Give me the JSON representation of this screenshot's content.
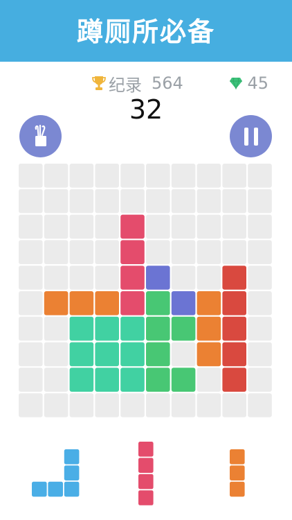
{
  "header": {
    "title": "蹲厕所必备"
  },
  "stats": {
    "record_label": "纪录",
    "record_value": "564",
    "gems_value": "45",
    "score": "32"
  },
  "colors": {
    "banner": "#46aee0",
    "empty": "#ebebeb",
    "pink": "#e44c6c",
    "blue": "#6b74d3",
    "orange": "#eb8133",
    "red": "#d9493f",
    "green": "#48c774",
    "teal": "#41d1a2",
    "cyan": "#4aaee6",
    "button": "#7b88d2"
  },
  "board": {
    "rows": 10,
    "cols": 10,
    "filled": [
      {
        "r": 2,
        "c": 4,
        "color": "pink"
      },
      {
        "r": 3,
        "c": 4,
        "color": "pink"
      },
      {
        "r": 4,
        "c": 4,
        "color": "pink"
      },
      {
        "r": 4,
        "c": 5,
        "color": "blue"
      },
      {
        "r": 4,
        "c": 8,
        "color": "red"
      },
      {
        "r": 5,
        "c": 1,
        "color": "orange"
      },
      {
        "r": 5,
        "c": 2,
        "color": "orange"
      },
      {
        "r": 5,
        "c": 3,
        "color": "orange"
      },
      {
        "r": 5,
        "c": 4,
        "color": "pink"
      },
      {
        "r": 5,
        "c": 5,
        "color": "green"
      },
      {
        "r": 5,
        "c": 6,
        "color": "blue"
      },
      {
        "r": 5,
        "c": 7,
        "color": "orange"
      },
      {
        "r": 5,
        "c": 8,
        "color": "red"
      },
      {
        "r": 6,
        "c": 2,
        "color": "teal"
      },
      {
        "r": 6,
        "c": 3,
        "color": "teal"
      },
      {
        "r": 6,
        "c": 4,
        "color": "teal"
      },
      {
        "r": 6,
        "c": 5,
        "color": "green"
      },
      {
        "r": 6,
        "c": 6,
        "color": "green"
      },
      {
        "r": 6,
        "c": 7,
        "color": "orange"
      },
      {
        "r": 6,
        "c": 8,
        "color": "red"
      },
      {
        "r": 7,
        "c": 2,
        "color": "teal"
      },
      {
        "r": 7,
        "c": 3,
        "color": "teal"
      },
      {
        "r": 7,
        "c": 4,
        "color": "teal"
      },
      {
        "r": 7,
        "c": 5,
        "color": "green"
      },
      {
        "r": 7,
        "c": 7,
        "color": "orange"
      },
      {
        "r": 7,
        "c": 8,
        "color": "red"
      },
      {
        "r": 8,
        "c": 2,
        "color": "teal"
      },
      {
        "r": 8,
        "c": 3,
        "color": "teal"
      },
      {
        "r": 8,
        "c": 4,
        "color": "teal"
      },
      {
        "r": 8,
        "c": 5,
        "color": "green"
      },
      {
        "r": 8,
        "c": 6,
        "color": "green"
      },
      {
        "r": 8,
        "c": 8,
        "color": "red"
      }
    ]
  },
  "tray": [
    {
      "name": "tray-piece-j",
      "color": "cyan",
      "cells": [
        [
          0,
          2
        ],
        [
          1,
          2
        ],
        [
          2,
          0
        ],
        [
          2,
          1
        ],
        [
          2,
          2
        ]
      ]
    },
    {
      "name": "tray-piece-i4",
      "color": "pink",
      "cells": [
        [
          0,
          0
        ],
        [
          1,
          0
        ],
        [
          2,
          0
        ],
        [
          3,
          0
        ]
      ]
    },
    {
      "name": "tray-piece-i3",
      "color": "orange",
      "cells": [
        [
          0,
          0
        ],
        [
          1,
          0
        ],
        [
          2,
          0
        ]
      ]
    }
  ],
  "icons": {
    "trophy": "trophy-icon",
    "gem": "gem-icon",
    "hammer": "hammer-icon",
    "pause": "pause-icon"
  }
}
